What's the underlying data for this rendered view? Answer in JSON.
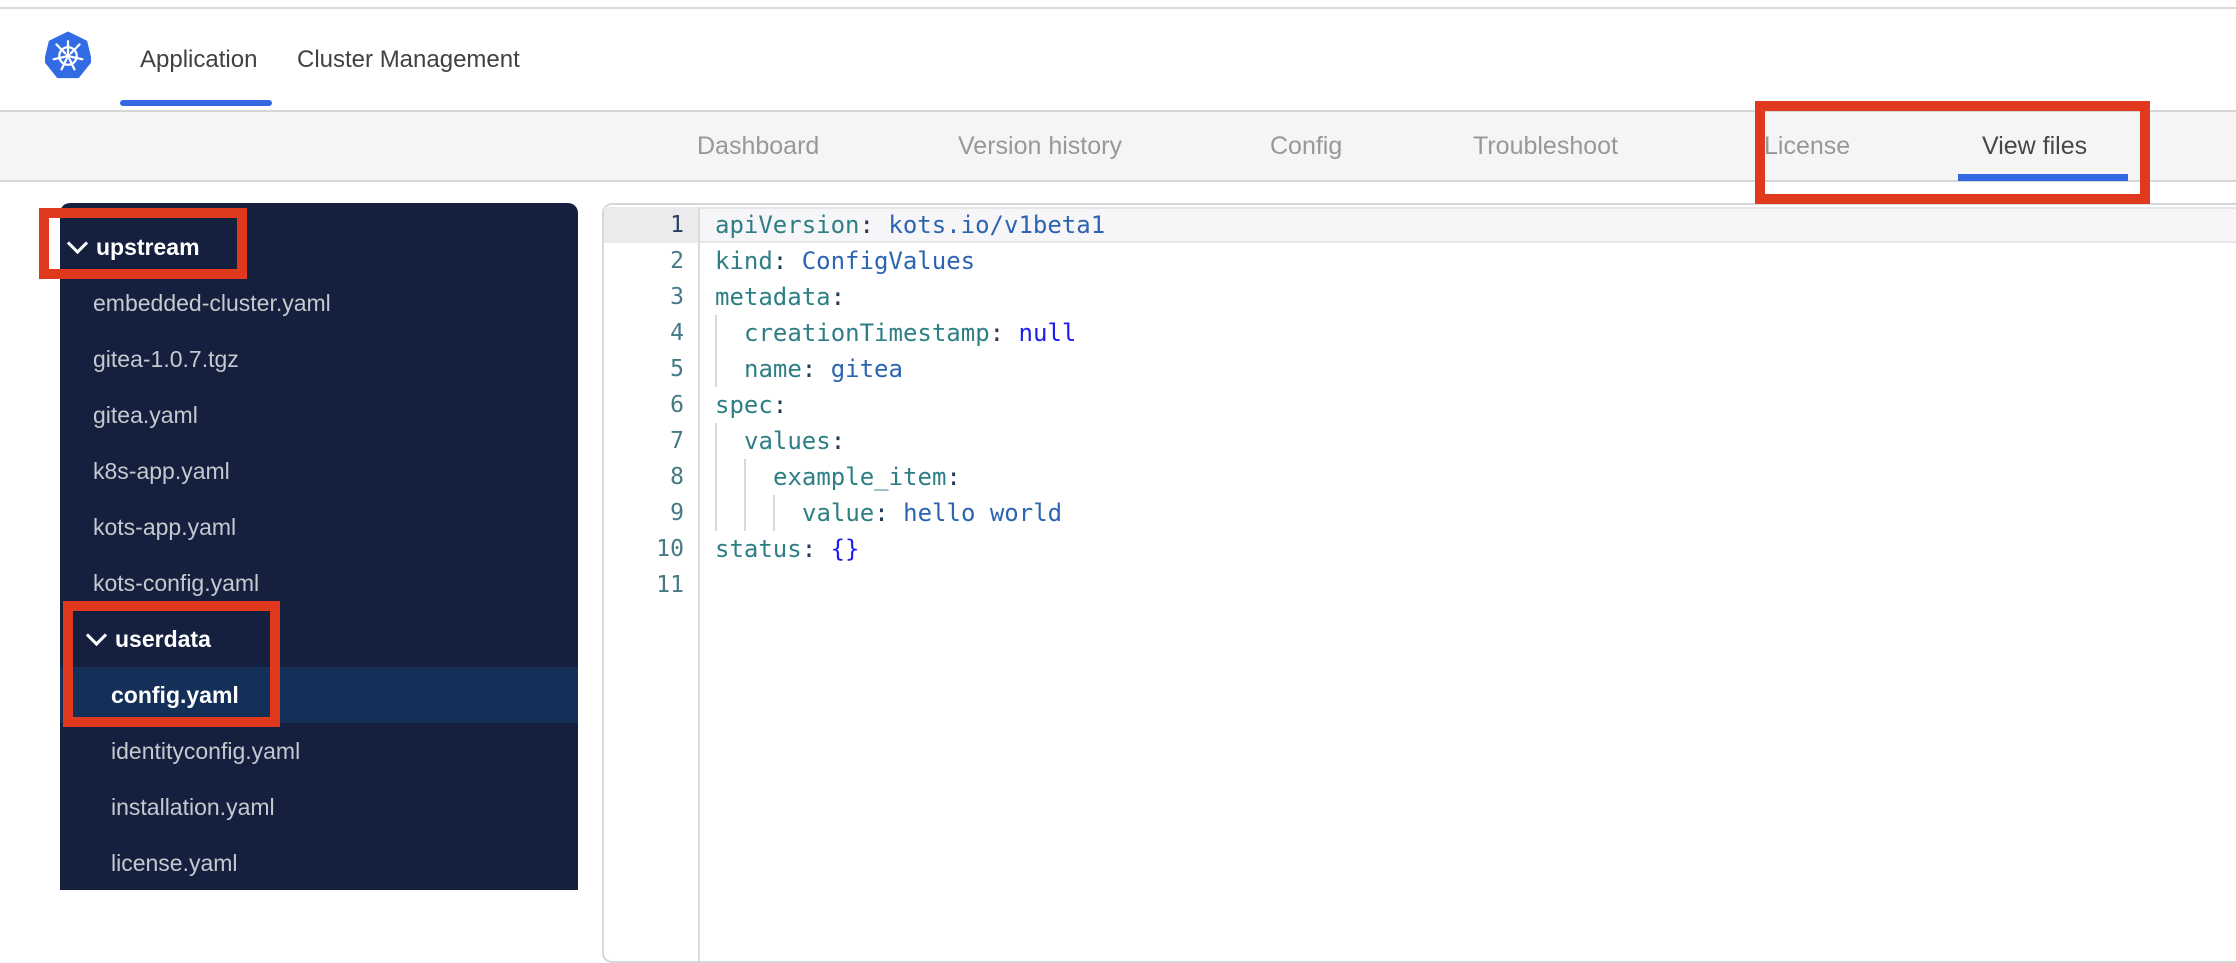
{
  "colors": {
    "accent": "#3568e4",
    "annotation": "#e0391d",
    "sidebar_bg": "#15203f",
    "sidebar_selected": "#153058",
    "key": "#2e7f85",
    "val": "#2c64b1",
    "kw": "#1c1cf0",
    "punc": "#223a54",
    "line_number": "#457a85",
    "logo_blue": "#326ce5"
  },
  "header": {
    "logo": "kubernetes-logo",
    "tabs": [
      {
        "label": "Application",
        "active": true
      },
      {
        "label": "Cluster Management",
        "active": false
      }
    ]
  },
  "nav": {
    "tabs": [
      {
        "label": "Dashboard",
        "active": false
      },
      {
        "label": "Version history",
        "active": false
      },
      {
        "label": "Config",
        "active": false
      },
      {
        "label": "Troubleshoot",
        "active": false
      },
      {
        "label": "License",
        "active": false
      },
      {
        "label": "View files",
        "active": true
      }
    ]
  },
  "file_tree": {
    "items": [
      {
        "type": "folder",
        "label": "upstream",
        "level": 0,
        "expanded": true
      },
      {
        "type": "file",
        "label": "embedded-cluster.yaml",
        "level": 0
      },
      {
        "type": "file",
        "label": "gitea-1.0.7.tgz",
        "level": 0
      },
      {
        "type": "file",
        "label": "gitea.yaml",
        "level": 0
      },
      {
        "type": "file",
        "label": "k8s-app.yaml",
        "level": 0
      },
      {
        "type": "file",
        "label": "kots-app.yaml",
        "level": 0
      },
      {
        "type": "file",
        "label": "kots-config.yaml",
        "level": 0
      },
      {
        "type": "folder",
        "label": "userdata",
        "level": 1,
        "expanded": true
      },
      {
        "type": "file",
        "label": "config.yaml",
        "level": 1,
        "selected": true
      },
      {
        "type": "file",
        "label": "identityconfig.yaml",
        "level": 1
      },
      {
        "type": "file",
        "label": "installation.yaml",
        "level": 1
      },
      {
        "type": "file",
        "label": "license.yaml",
        "level": 1
      }
    ]
  },
  "editor": {
    "language": "yaml",
    "lines": [
      {
        "n": "1",
        "indent": 0,
        "active": true,
        "tokens": [
          [
            "key",
            "apiVersion"
          ],
          [
            "punc",
            ": "
          ],
          [
            "val",
            "kots.io/v1beta1"
          ]
        ]
      },
      {
        "n": "2",
        "indent": 0,
        "tokens": [
          [
            "key",
            "kind"
          ],
          [
            "punc",
            ": "
          ],
          [
            "val",
            "ConfigValues"
          ]
        ]
      },
      {
        "n": "3",
        "indent": 0,
        "tokens": [
          [
            "key",
            "metadata"
          ],
          [
            "punc",
            ":"
          ]
        ]
      },
      {
        "n": "4",
        "indent": 2,
        "tokens": [
          [
            "key",
            "creationTimestamp"
          ],
          [
            "punc",
            ": "
          ],
          [
            "kw",
            "null"
          ]
        ]
      },
      {
        "n": "5",
        "indent": 2,
        "tokens": [
          [
            "key",
            "name"
          ],
          [
            "punc",
            ": "
          ],
          [
            "val",
            "gitea"
          ]
        ]
      },
      {
        "n": "6",
        "indent": 0,
        "tokens": [
          [
            "key",
            "spec"
          ],
          [
            "punc",
            ":"
          ]
        ]
      },
      {
        "n": "7",
        "indent": 2,
        "tokens": [
          [
            "key",
            "values"
          ],
          [
            "punc",
            ":"
          ]
        ]
      },
      {
        "n": "8",
        "indent": 4,
        "tokens": [
          [
            "key",
            "example_item"
          ],
          [
            "punc",
            ":"
          ]
        ]
      },
      {
        "n": "9",
        "indent": 6,
        "tokens": [
          [
            "key",
            "value"
          ],
          [
            "punc",
            ": "
          ],
          [
            "val",
            "hello world"
          ]
        ]
      },
      {
        "n": "10",
        "indent": 0,
        "tokens": [
          [
            "key",
            "status"
          ],
          [
            "punc",
            ": "
          ],
          [
            "kw",
            "{}"
          ]
        ]
      },
      {
        "n": "11",
        "indent": 0,
        "tokens": []
      }
    ]
  },
  "annotations": {
    "boxes": [
      {
        "target": "upstream-folder"
      },
      {
        "target": "userdata-folder-and-config-yaml"
      },
      {
        "target": "view-files-tab"
      }
    ]
  }
}
